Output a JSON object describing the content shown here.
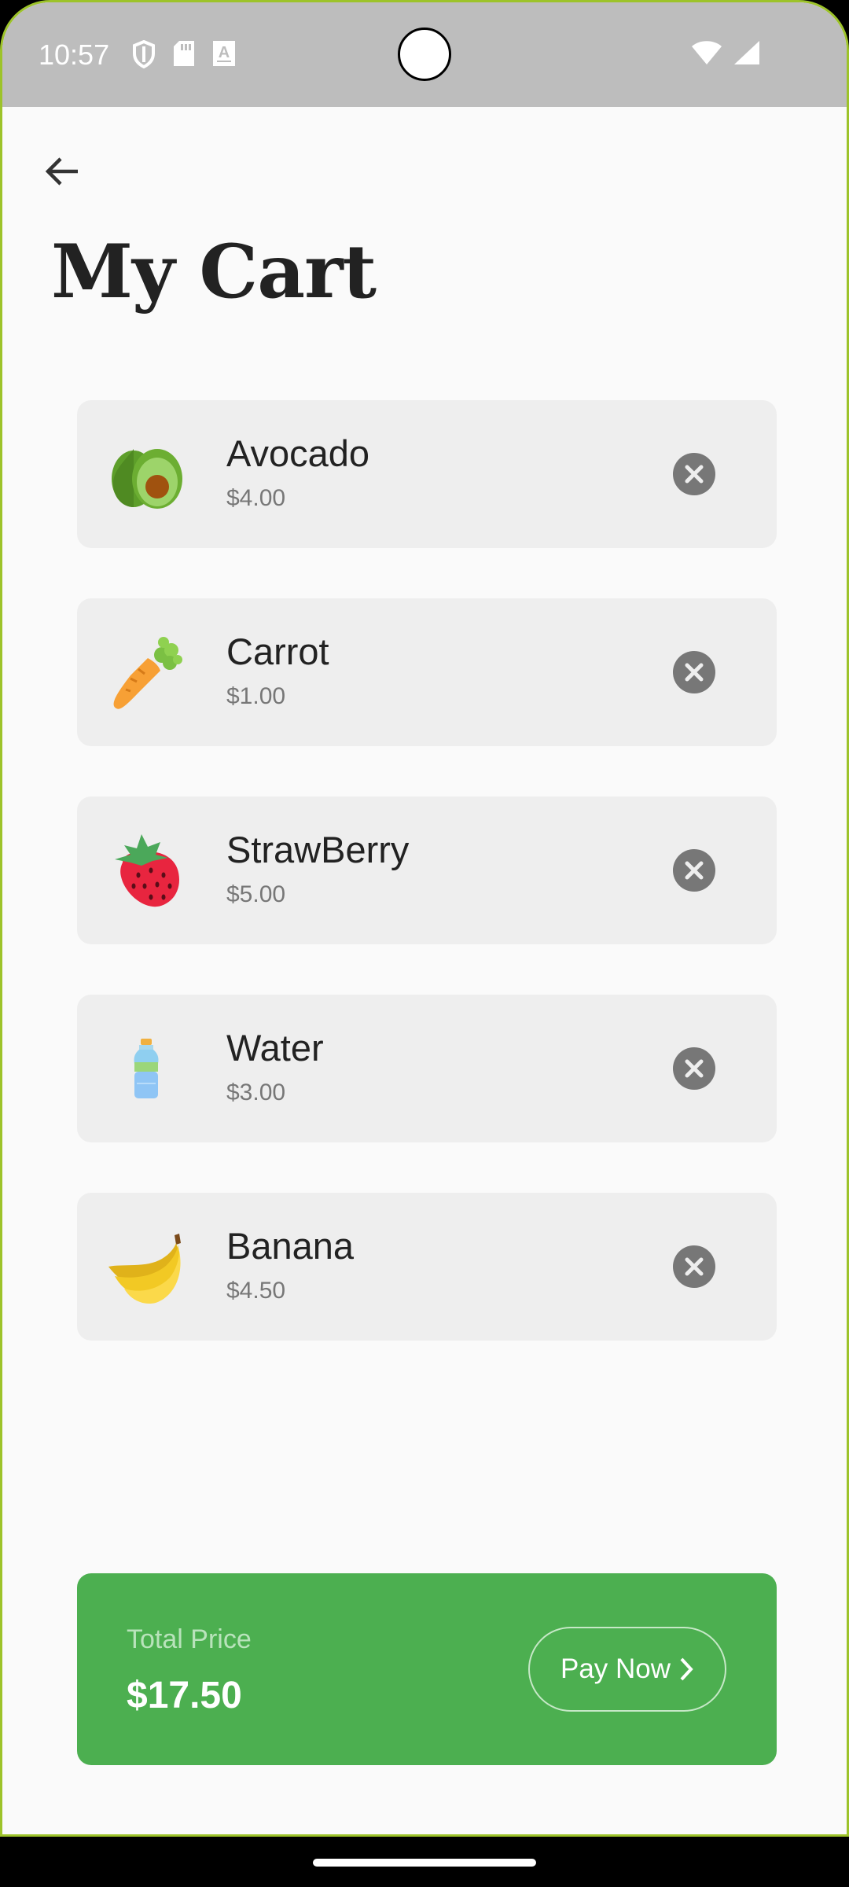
{
  "status_bar": {
    "time": "10:57",
    "icons_left": [
      "shield-icon",
      "sd-card-icon",
      "a-badge-icon"
    ],
    "icons_right": [
      "wifi-icon",
      "cell-signal-icon"
    ]
  },
  "header": {
    "back_icon": "arrow-left-icon",
    "title": "My Cart"
  },
  "cart": {
    "items": [
      {
        "name": "Avocado",
        "price": "$4.00",
        "icon": "avocado-icon"
      },
      {
        "name": "Carrot",
        "price": "$1.00",
        "icon": "carrot-icon"
      },
      {
        "name": "StrawBerry",
        "price": "$5.00",
        "icon": "strawberry-icon"
      },
      {
        "name": "Water",
        "price": "$3.00",
        "icon": "water-bottle-icon"
      },
      {
        "name": "Banana",
        "price": "$4.50",
        "icon": "banana-icon"
      }
    ],
    "remove_icon": "close-circle-icon"
  },
  "checkout": {
    "total_label": "Total Price",
    "total_value": "$17.50",
    "pay_label": "Pay Now",
    "pay_icon": "chevron-right-icon"
  },
  "colors": {
    "accent_green": "#4caf50",
    "card_bg": "#eeeeee",
    "status_bar": "#bdbdbd",
    "frame_border": "#9dc32a"
  }
}
